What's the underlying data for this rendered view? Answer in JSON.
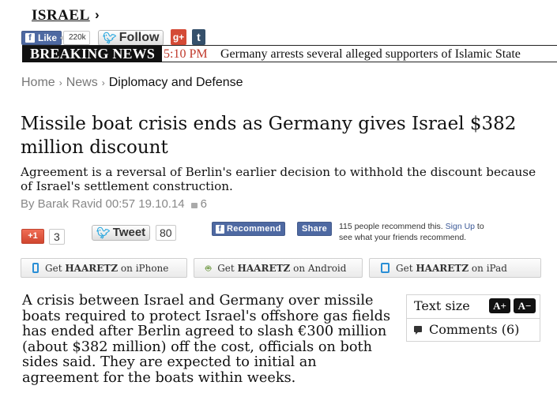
{
  "section": {
    "title": "ISRAEL",
    "arrow": "›"
  },
  "social_top": {
    "fb_like_label": "Like",
    "fb_like_count": "220k",
    "tw_follow_label": "Follow",
    "gplus_label": "g+",
    "tumblr_label": "t"
  },
  "breaking": {
    "label": "BREAKING NEWS",
    "time": "5:10 PM",
    "text": "Germany arrests several alleged supporters of Islamic State"
  },
  "breadcrumb": {
    "home": "Home",
    "news": "News",
    "current": "Diplomacy and Defense",
    "sep": "›"
  },
  "article": {
    "headline": "Missile boat crisis ends as Germany gives Israel $382 million discount",
    "subhead": "Agreement is a reversal of Berlin's earlier decision to withhold the discount because of Israel's settlement construction.",
    "byline": "By Barak Ravid 00:57 19.10.14",
    "comment_count": "6",
    "lead": "A crisis between Israel and Germany over missile boats required to protect Israel's offshore gas fields has ended after Berlin agreed to slash €300 million (about $382 million) off the cost, officials on both sides said. They are expected to initial an agreement for the boats within weeks."
  },
  "share": {
    "gplus_label": "+1",
    "gplus_count": "3",
    "tweet_label": "Tweet",
    "tweet_count": "80",
    "fb_recommend_label": "Recommend",
    "fb_share_label": "Share",
    "fb_social_text": "115 people recommend this.",
    "fb_signup_link": "Sign Up",
    "fb_social_tail": "to see what your friends recommend."
  },
  "apps": [
    {
      "prefix": "Get ",
      "brand": "HAARETZ",
      "suffix": " on iPhone",
      "icon": "phone-icon"
    },
    {
      "prefix": "Get ",
      "brand": "HAARETZ",
      "suffix": " on Android",
      "icon": "android-icon"
    },
    {
      "prefix": "Get ",
      "brand": "HAARETZ",
      "suffix": " on iPad",
      "icon": "tablet-icon"
    }
  ],
  "sidebox": {
    "text_size_label": "Text size",
    "increase_label": "A+",
    "decrease_label": "A−",
    "comments_label": "Comments (6)"
  },
  "colors": {
    "facebook": "#4e69a2",
    "twitter": "#2ea9df",
    "google_plus": "#d44a36",
    "tumblr": "#35506b",
    "breaking_time": "#c0392b"
  }
}
